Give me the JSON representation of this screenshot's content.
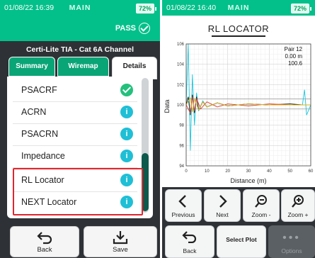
{
  "left": {
    "status": {
      "datetime": "01/08/22 16:39",
      "title": "MAIN",
      "battery": "72%"
    },
    "pass_label": "PASS",
    "cable_title": "Certi-Lite TIA - Cat 6A Channel",
    "tabs": {
      "summary": "Summary",
      "wiremap": "Wiremap",
      "details": "Details"
    },
    "rows": [
      {
        "label": "PSACRF",
        "status": "pass"
      },
      {
        "label": "ACRN",
        "status": "info"
      },
      {
        "label": "PSACRN",
        "status": "info"
      },
      {
        "label": "Impedance",
        "status": "info"
      },
      {
        "label": "RL Locator",
        "status": "info"
      },
      {
        "label": "NEXT Locator",
        "status": "info"
      }
    ],
    "info_glyph": "i",
    "buttons": {
      "back": "Back",
      "save": "Save"
    }
  },
  "right": {
    "status": {
      "datetime": "01/08/22 16:40",
      "title": "MAIN",
      "battery": "72%"
    },
    "screen_title": "RL LOCATOR",
    "readout": {
      "pair": "Pair 12",
      "distance": "0.00 m",
      "value": "100.6"
    },
    "buttons": {
      "previous": "Previous",
      "next": "Next",
      "zoom_out": "Zoom -",
      "zoom_in": "Zoom +",
      "back": "Back",
      "select_plot": "Select Plot",
      "options": "Options"
    }
  },
  "chart_data": {
    "type": "line",
    "title": "",
    "xlabel": "Distance (m)",
    "ylabel": "Data",
    "xlim": [
      0,
      60
    ],
    "ylim": [
      94,
      106
    ],
    "x_ticks": [
      "0",
      "10",
      "20",
      "30",
      "40",
      "50",
      "60"
    ],
    "y_ticks": [
      "94",
      "96",
      "98",
      "100",
      "102",
      "104",
      "106"
    ],
    "grid": true,
    "series": [
      {
        "color": "#1cc6dc",
        "x": [
          0,
          1,
          2,
          3,
          4,
          5,
          6,
          8,
          10,
          15,
          20,
          30,
          40,
          50,
          56,
          57,
          58,
          60
        ],
        "y": [
          100,
          106,
          95.5,
          103,
          98,
          101.2,
          99.4,
          100.4,
          99.8,
          100.2,
          99.9,
          100.1,
          100,
          100,
          100,
          101.5,
          99,
          100
        ]
      },
      {
        "color": "#111111",
        "x": [
          0,
          1,
          2,
          3,
          4,
          5,
          6,
          8,
          10,
          15,
          20,
          30,
          40,
          50,
          56,
          60
        ],
        "y": [
          100,
          100.8,
          99.0,
          101.0,
          99.2,
          100.8,
          99.5,
          100.3,
          99.8,
          100.2,
          99.9,
          100.1,
          100,
          100.1,
          100,
          100
        ]
      },
      {
        "color": "#e03a2f",
        "x": [
          0,
          2,
          3,
          4,
          5,
          7,
          10,
          15,
          20,
          30,
          40,
          50,
          60
        ],
        "y": [
          100,
          99.2,
          100.8,
          99.4,
          100.6,
          99.6,
          100.3,
          99.8,
          100.1,
          99.9,
          100.1,
          100,
          100
        ]
      },
      {
        "color": "#e0b51a",
        "x": [
          0,
          2,
          3,
          4,
          6,
          8,
          10,
          15,
          20,
          30,
          40,
          50,
          60
        ],
        "y": [
          100,
          100.7,
          99.3,
          100.6,
          99.5,
          100.3,
          99.8,
          100.2,
          99.9,
          100.1,
          100,
          100,
          100
        ]
      }
    ],
    "reference_lines": {
      "color": "#9a9a9a",
      "y": [
        100.6,
        99.6
      ]
    }
  }
}
